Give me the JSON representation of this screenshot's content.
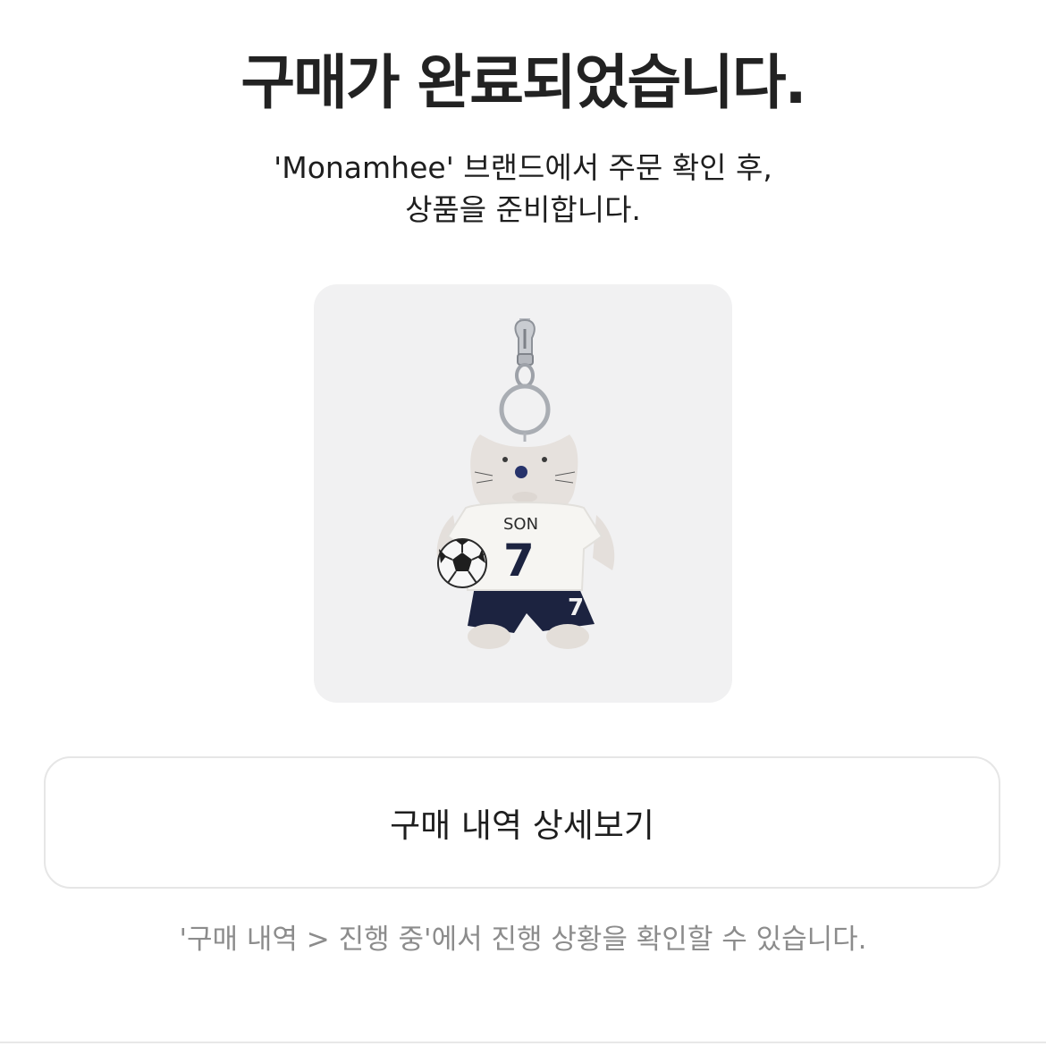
{
  "header": {
    "title": "구매가 완료되었습니다."
  },
  "message": {
    "line1": "'Monamhee' 브랜드에서 주문 확인 후,",
    "line2": "상품을 준비합니다."
  },
  "product": {
    "image_icon": "plush-keychain-image",
    "shirt_name": "SON",
    "shirt_number": "7",
    "shorts_number": "7"
  },
  "actions": {
    "detail_label": "구매 내역 상세보기"
  },
  "footer": {
    "hint": "'구매 내역 > 진행 중'에서 진행 상황을 확인할 수 있습니다."
  },
  "colors": {
    "card_background": "#f1f1f2",
    "button_border": "#e6e6e6",
    "hint_text": "#8c8c8c",
    "navy": "#1c2340"
  }
}
